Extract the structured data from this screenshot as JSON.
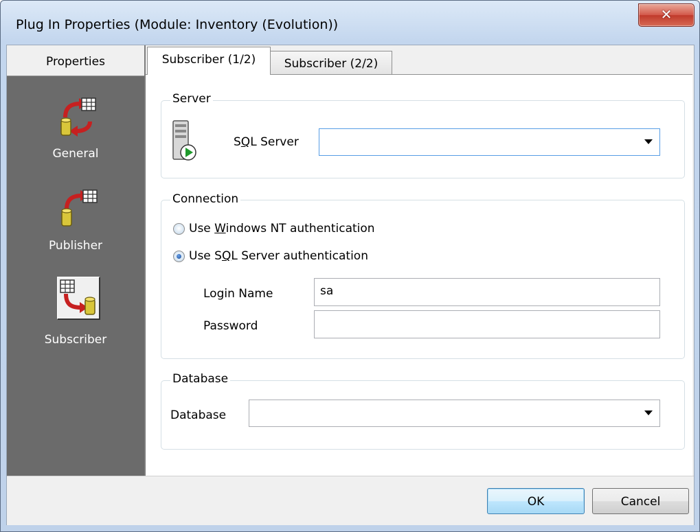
{
  "window": {
    "title": "Plug In Properties (Module: Inventory (Evolution))",
    "close_glyph": "✕"
  },
  "sidebar": {
    "header": "Properties",
    "items": [
      {
        "label": "General",
        "icon": "general-icon"
      },
      {
        "label": "Publisher",
        "icon": "publisher-icon"
      },
      {
        "label": "Subscriber",
        "icon": "subscriber-icon",
        "selected": true
      }
    ]
  },
  "tabs": [
    {
      "label": "Subscriber (1/2)",
      "active": true
    },
    {
      "label": "Subscriber (2/2)",
      "active": false
    }
  ],
  "server": {
    "group_label": "Server",
    "sql_server_label_pre": "S",
    "sql_server_label_u": "Q",
    "sql_server_label_post": "L Server",
    "sql_server_value": ""
  },
  "connection": {
    "group_label": "Connection",
    "windows_auth_pre": "Use ",
    "windows_auth_u": "W",
    "windows_auth_post": "indows NT authentication",
    "sql_auth_pre": "Use S",
    "sql_auth_u": "Q",
    "sql_auth_post": "L Server authentication",
    "selected": "sql",
    "login_name_label": "Login Name",
    "login_name_value": "sa",
    "password_label": "Password",
    "password_value": ""
  },
  "database": {
    "group_label": "Database",
    "database_label": "Database",
    "database_value": ""
  },
  "footer": {
    "ok_label": "OK",
    "cancel_label": "Cancel"
  }
}
